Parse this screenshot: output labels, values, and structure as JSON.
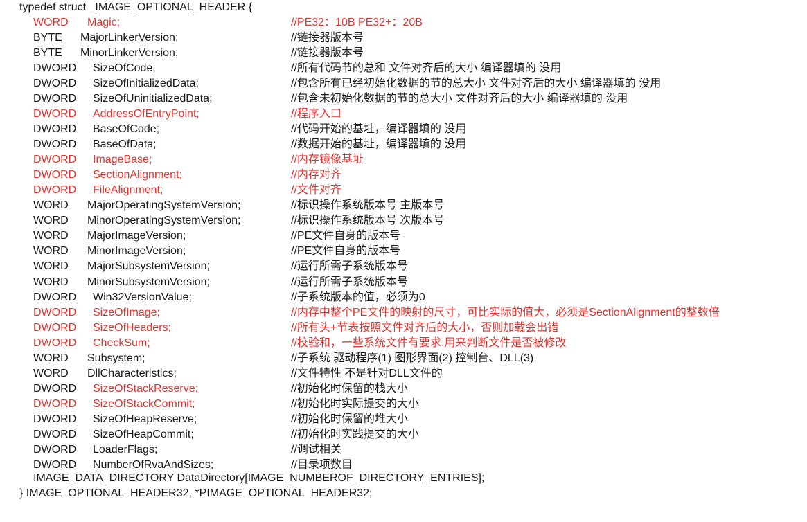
{
  "header": "typedef struct _IMAGE_OPTIONAL_HEADER {",
  "fields": [
    {
      "type": "WORD",
      "name": "Magic;",
      "comment": "//PE32：10B    PE32+：20B",
      "red_type": true,
      "red_name": true,
      "red_comment": true,
      "indent": "w"
    },
    {
      "type": "BYTE",
      "name": "MajorLinkerVersion;",
      "comment": "//链接器版本号",
      "indent": "b"
    },
    {
      "type": "BYTE",
      "name": "MinorLinkerVersion;",
      "comment": "//链接器版本号",
      "indent": "b"
    },
    {
      "type": "DWORD",
      "name": "SizeOfCode;",
      "comment": "//所有代码节的总和   文件对齐后的大小  编译器填的  没用"
    },
    {
      "type": "DWORD",
      "name": "SizeOfInitializedData;",
      "comment": "//包含所有已经初始化数据的节的总大小  文件对齐后的大小 编译器填的  没用"
    },
    {
      "type": "DWORD",
      "name": "SizeOfUninitializedData;",
      "comment": "//包含未初始化数据的节的总大小 文件对齐后的大小 编译器填的  没用"
    },
    {
      "type": "DWORD",
      "name": "AddressOfEntryPoint;",
      "comment": "//程序入口",
      "red_type": true,
      "red_name": true,
      "red_comment": true
    },
    {
      "type": "DWORD",
      "name": "BaseOfCode;",
      "comment": "//代码开始的基址，编译器填的   没用"
    },
    {
      "type": "DWORD",
      "name": "BaseOfData;",
      "comment": "//数据开始的基址，编译器填的   没用"
    },
    {
      "type": "DWORD",
      "name": "ImageBase;",
      "comment": "//内存镜像基址",
      "red_type": true,
      "red_name": true,
      "red_comment": true
    },
    {
      "type": "DWORD",
      "name": "SectionAlignment;",
      "comment": "//内存对齐",
      "red_type": true,
      "red_name": true,
      "red_comment": true
    },
    {
      "type": "DWORD",
      "name": "FileAlignment;",
      "comment": "//文件对齐",
      "red_type": true,
      "red_name": true,
      "red_comment": true
    },
    {
      "type": "WORD",
      "name": "MajorOperatingSystemVersion;",
      "comment": "//标识操作系统版本号 主版本号",
      "indent": "w2"
    },
    {
      "type": "WORD",
      "name": "MinorOperatingSystemVersion;",
      "comment": "//标识操作系统版本号 次版本号",
      "indent": "w2"
    },
    {
      "type": "WORD",
      "name": "MajorImageVersion;",
      "comment": "//PE文件自身的版本号",
      "indent": "w2"
    },
    {
      "type": "WORD",
      "name": "MinorImageVersion;",
      "comment": "//PE文件自身的版本号",
      "indent": "w2"
    },
    {
      "type": "WORD",
      "name": "MajorSubsystemVersion;",
      "comment": "//运行所需子系统版本号",
      "indent": "w2"
    },
    {
      "type": "WORD",
      "name": "MinorSubsystemVersion;",
      "comment": "//运行所需子系统版本号",
      "indent": "w2"
    },
    {
      "type": "DWORD",
      "name": "Win32VersionValue;",
      "comment": "//子系统版本的值，必须为0"
    },
    {
      "type": "DWORD",
      "name": "SizeOfImage;",
      "comment": "//内存中整个PE文件的映射的尺寸，可比实际的值大，必须是SectionAlignment的整数倍",
      "red_type": true,
      "red_name": true,
      "red_comment": true
    },
    {
      "type": "DWORD",
      "name": "SizeOfHeaders;",
      "comment": "//所有头+节表按照文件对齐后的大小，否则加载会出错",
      "red_type": true,
      "red_name": true,
      "red_comment": true
    },
    {
      "type": "DWORD",
      "name": "CheckSum;",
      "comment": "//校验和，一些系统文件有要求.用来判断文件是否被修改",
      "red_type": true,
      "red_name": true,
      "red_comment": true
    },
    {
      "type": "WORD",
      "name": "Subsystem;",
      "comment": "//子系统              驱动程序(1)  图形界面(2)  控制台、DLL(3)",
      "indent": "w2"
    },
    {
      "type": "WORD",
      "name": "DllCharacteristics;",
      "comment": "//文件特性 不是针对DLL文件的",
      "indent": "w2"
    },
    {
      "type": "DWORD",
      "name": "SizeOfStackReserve;",
      "comment": "//初始化时保留的栈大小",
      "red_name": true
    },
    {
      "type": "DWORD",
      "name": "SizeOfStackCommit;",
      "comment": "//初始化时实际提交的大小",
      "red_type": true,
      "red_name": true
    },
    {
      "type": "DWORD",
      "name": "SizeOfHeapReserve;",
      "comment": "//初始化时保留的堆大小"
    },
    {
      "type": "DWORD",
      "name": "SizeOfHeapCommit;",
      "comment": "//初始化时实践提交的大小"
    },
    {
      "type": "DWORD",
      "name": "LoaderFlags;",
      "comment": "//调试相关"
    },
    {
      "type": "DWORD",
      "name": "NumberOfRvaAndSizes;",
      "comment": "//目录项数目"
    }
  ],
  "array_line": "IMAGE_DATA_DIRECTORY DataDirectory[IMAGE_NUMBEROF_DIRECTORY_ENTRIES];",
  "closer": "} IMAGE_OPTIONAL_HEADER32, *PIMAGE_OPTIONAL_HEADER32;",
  "colors": {
    "text": "#1a1a1a",
    "highlight": "#e8302c",
    "background": "#ffffff"
  }
}
